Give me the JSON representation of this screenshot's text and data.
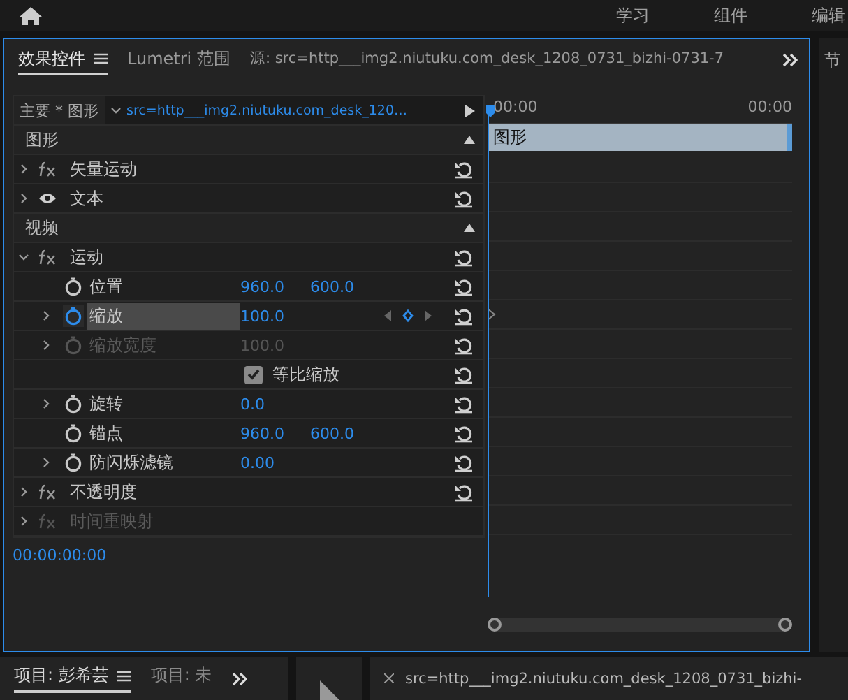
{
  "topbar": {
    "workspaces": [
      {
        "label": "学习"
      },
      {
        "label": "组件"
      },
      {
        "label": "编辑"
      }
    ]
  },
  "panel": {
    "tabs": [
      {
        "label": "效果控件",
        "selected": true
      },
      {
        "label": "Lumetri 范围",
        "selected": false
      },
      {
        "label": "源: src=http___img2.niutuku.com_desk_1208_0731_bizhi-0731-7",
        "selected": false
      }
    ],
    "clip_header": {
      "master": "主要 * 图形",
      "clip": "src=http___img2.niutuku.com_desk_120…"
    },
    "timeline": {
      "start": "00:00",
      "end": "00:00",
      "clip_label": "图形"
    },
    "rows": [
      {
        "kind": "section",
        "label": "图形"
      },
      {
        "kind": "effect",
        "label": "矢量运动",
        "expanded": false,
        "disabled": false,
        "reset": true
      },
      {
        "kind": "layer",
        "label": "文本",
        "expanded": false,
        "disabled": false,
        "reset": true
      },
      {
        "kind": "section",
        "label": "视频"
      },
      {
        "kind": "effect",
        "label": "运动",
        "expanded": true,
        "disabled": false,
        "reset": true
      },
      {
        "kind": "param",
        "label": "位置",
        "values": [
          "960.0",
          "600.0"
        ],
        "expandable": false,
        "animated": false,
        "selected": false,
        "disabled": false,
        "reset": true
      },
      {
        "kind": "param",
        "label": "缩放",
        "values": [
          "100.0"
        ],
        "expandable": true,
        "animated": true,
        "selected": true,
        "disabled": false,
        "reset": true
      },
      {
        "kind": "param",
        "label": "缩放宽度",
        "values": [
          "100.0"
        ],
        "expandable": true,
        "animated": false,
        "selected": false,
        "disabled": true,
        "reset": true
      },
      {
        "kind": "checkbox",
        "label": "等比缩放",
        "checked": true,
        "reset": true
      },
      {
        "kind": "param",
        "label": "旋转",
        "values": [
          "0.0"
        ],
        "expandable": true,
        "animated": false,
        "selected": false,
        "disabled": false,
        "reset": true
      },
      {
        "kind": "param",
        "label": "锚点",
        "values": [
          "960.0",
          "600.0"
        ],
        "expandable": false,
        "animated": false,
        "selected": false,
        "disabled": false,
        "reset": true
      },
      {
        "kind": "param",
        "label": "防闪烁滤镜",
        "values": [
          "0.00"
        ],
        "expandable": true,
        "animated": false,
        "selected": false,
        "disabled": false,
        "reset": true
      },
      {
        "kind": "effect",
        "label": "不透明度",
        "expanded": false,
        "disabled": false,
        "reset": true
      },
      {
        "kind": "effect",
        "label": "时间重映射",
        "expanded": false,
        "disabled": true,
        "reset": false
      }
    ],
    "timecode": "00:00:00:00"
  },
  "right_strip": {
    "label": "节"
  },
  "bottom": {
    "tabs": [
      {
        "label": "项目: 彭希芸",
        "selected": true
      },
      {
        "label": "项目: 未",
        "selected": false
      }
    ],
    "source_tab": "src=http___img2.niutuku.com_desk_1208_0731_bizhi-"
  }
}
